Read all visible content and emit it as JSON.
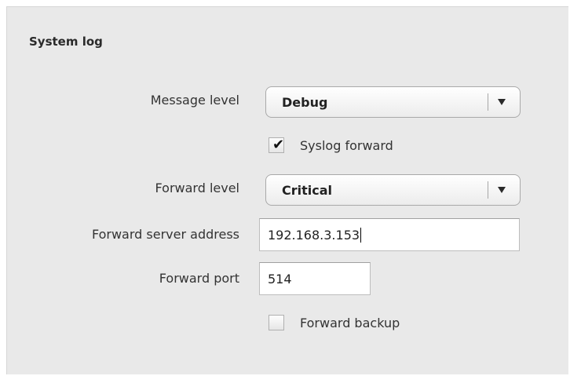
{
  "section": {
    "title": "System log"
  },
  "fields": {
    "message_level": {
      "label": "Message level",
      "value": "Debug"
    },
    "syslog_forward": {
      "label": "Syslog forward",
      "checked": true
    },
    "forward_level": {
      "label": "Forward level",
      "value": "Critical"
    },
    "forward_server_address": {
      "label": "Forward server address",
      "value": "192.168.3.153"
    },
    "forward_port": {
      "label": "Forward port",
      "value": "514"
    },
    "forward_backup": {
      "label": "Forward backup",
      "checked": false
    }
  },
  "icons": {
    "dropdown": "chevron-down-icon",
    "check": "checkmark-icon"
  },
  "colors": {
    "panel_background": "#e9e9e9",
    "text": "#333333"
  }
}
